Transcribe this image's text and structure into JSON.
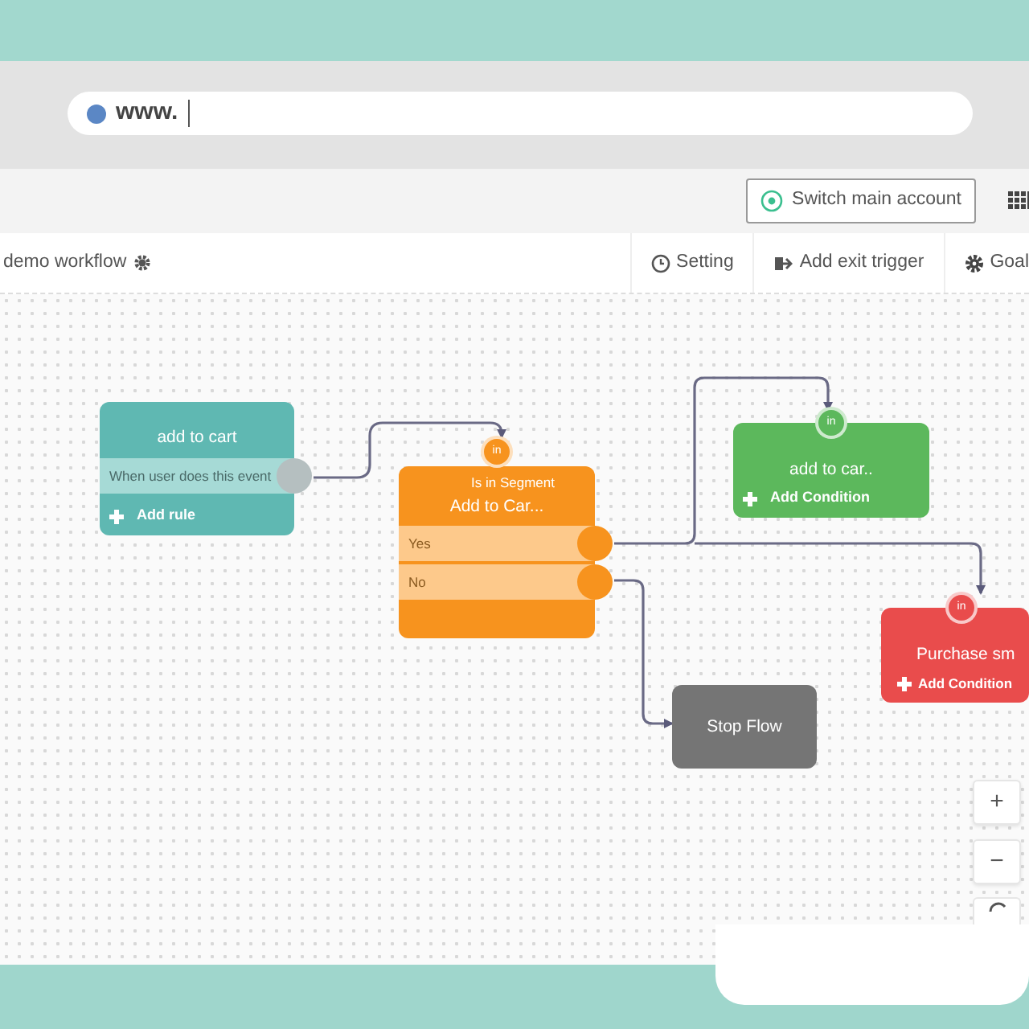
{
  "browser": {
    "url": "www."
  },
  "header": {
    "switch_button": "Switch main account"
  },
  "toolbar": {
    "workflow_name": "demo workflow",
    "actions": [
      {
        "label": "Setting",
        "kind": "clock"
      },
      {
        "label": "Add exit trigger",
        "kind": "exit"
      },
      {
        "label": "Goal",
        "kind": "gear"
      }
    ]
  },
  "nodes": [
    {
      "kind": "trigger",
      "color": "#5fb8b2",
      "title": "add to cart",
      "rows": [
        {
          "label": "When user does this event"
        }
      ],
      "add_label": "Add rule"
    },
    {
      "kind": "condition",
      "color": "#f7931e",
      "badge": "in",
      "subtitle": "Is in Segment",
      "title": "Add to Car...",
      "rows": [
        {
          "label": "Yes"
        },
        {
          "label": "No"
        }
      ]
    },
    {
      "kind": "action",
      "color": "#5cb85c",
      "badge": "in",
      "title": "add to car..",
      "add_label": "Add Condition"
    },
    {
      "kind": "action",
      "color": "#e94c4c",
      "badge": "in",
      "title": "Purchase sm",
      "add_label": "Add Condition"
    },
    {
      "kind": "stop",
      "color": "#757575",
      "title": "Stop Flow"
    }
  ],
  "zoom_controls": [
    {
      "kind": "plus",
      "label": "+"
    },
    {
      "kind": "minus",
      "label": "−"
    },
    {
      "kind": "reset"
    }
  ]
}
